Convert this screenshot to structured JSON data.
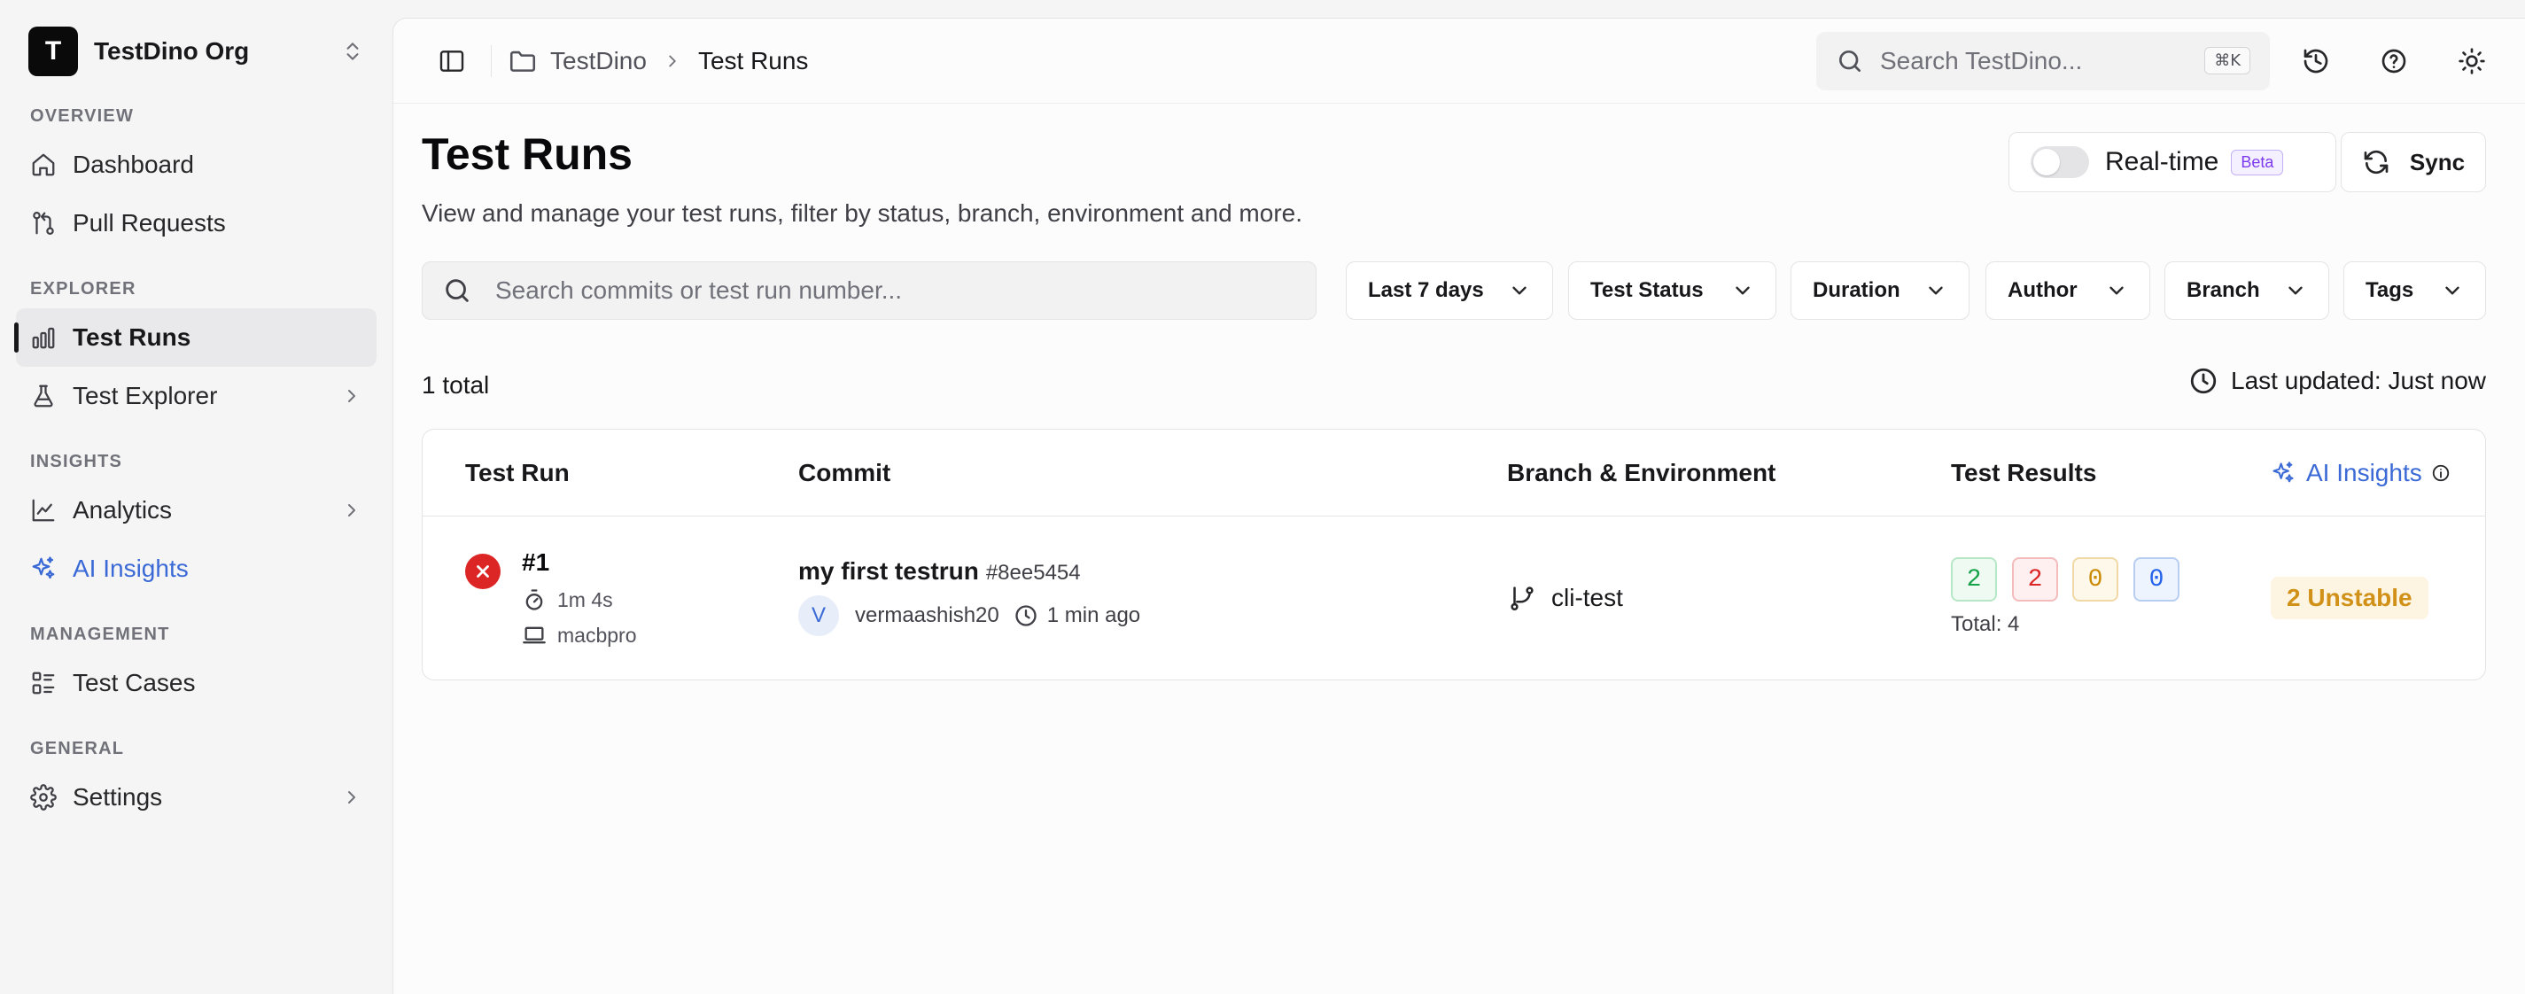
{
  "sidebar": {
    "org_initial": "T",
    "org_name": "TestDino Org",
    "sections": {
      "overview": "OVERVIEW",
      "explorer": "EXPLORER",
      "insights": "INSIGHTS",
      "management": "MANAGEMENT",
      "general": "GENERAL"
    },
    "items": {
      "dashboard": "Dashboard",
      "pull_requests": "Pull Requests",
      "test_runs": "Test Runs",
      "test_explorer": "Test Explorer",
      "analytics": "Analytics",
      "ai_insights": "AI Insights",
      "test_cases": "Test Cases",
      "settings": "Settings"
    },
    "active_item": "test_runs"
  },
  "topbar": {
    "breadcrumb": [
      "TestDino",
      "Test Runs"
    ],
    "search_placeholder": "Search TestDino...",
    "search_shortcut": "⌘K",
    "icons": [
      "history-icon",
      "help-icon",
      "theme-sun-icon"
    ]
  },
  "page": {
    "title": "Test Runs",
    "subtitle": "View and manage your test runs, filter by status, branch, environment and more.",
    "realtime_label": "Real-time",
    "realtime_badge": "Beta",
    "realtime_enabled": false,
    "sync_label": "Sync",
    "search_placeholder": "Search commits or test run number...",
    "filters": [
      "Last 7 days",
      "Test Status",
      "Duration",
      "Author",
      "Branch",
      "Tags"
    ],
    "total": "1 total",
    "last_updated": "Last updated: Just now"
  },
  "table": {
    "headers": [
      "Test Run",
      "Commit",
      "Branch & Environment",
      "Test Results",
      "AI Insights"
    ],
    "rows": [
      {
        "status": "failed",
        "run_number": "#1",
        "duration": "1m 4s",
        "machine": "macbpro",
        "commit_message": "my first testrun",
        "commit_hash": "#8ee5454",
        "author_initial": "V",
        "author": "vermaashish20",
        "time_ago": "1 min ago",
        "branch": "cli-test",
        "results": {
          "passed": "2",
          "failed": "2",
          "flaky": "0",
          "skipped": "0"
        },
        "results_total": "Total: 4",
        "ai_insight": "2 Unstable"
      }
    ]
  },
  "colors": {
    "accent": "#3b6ad6",
    "pass": "#16a34a",
    "fail": "#dc2626",
    "flaky": "#ca8a04",
    "skip": "#2563eb",
    "unstable": "#d19118"
  }
}
